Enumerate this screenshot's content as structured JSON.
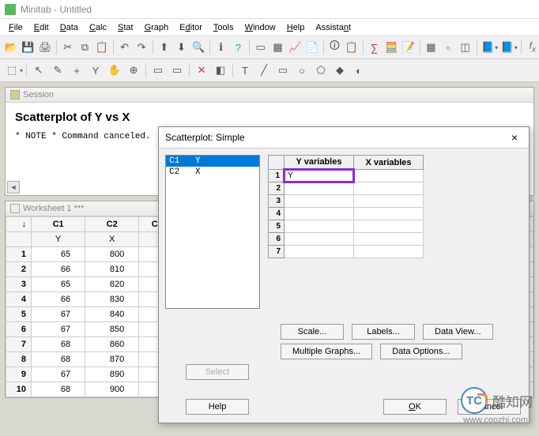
{
  "window": {
    "app": "Minitab",
    "doc": "Untitled"
  },
  "menu": [
    "File",
    "Edit",
    "Data",
    "Calc",
    "Stat",
    "Graph",
    "Editor",
    "Tools",
    "Window",
    "Help",
    "Assistant"
  ],
  "session": {
    "title": "Session",
    "heading": "Scatterplot of Y vs X",
    "note": "* NOTE * Command canceled."
  },
  "worksheet": {
    "title": "Worksheet 1 ***",
    "columns": [
      "C1",
      "C2",
      "C"
    ],
    "extracol": "10",
    "subheads": [
      "Y",
      "X",
      ""
    ],
    "rows": [
      {
        "n": 1,
        "c1": 65,
        "c2": 800
      },
      {
        "n": 2,
        "c1": 66,
        "c2": 810
      },
      {
        "n": 3,
        "c1": 65,
        "c2": 820
      },
      {
        "n": 4,
        "c1": 66,
        "c2": 830
      },
      {
        "n": 5,
        "c1": 67,
        "c2": 840
      },
      {
        "n": 6,
        "c1": 67,
        "c2": 850
      },
      {
        "n": 7,
        "c1": 68,
        "c2": 860
      },
      {
        "n": 8,
        "c1": 68,
        "c2": 870
      },
      {
        "n": 9,
        "c1": 67,
        "c2": 890
      },
      {
        "n": 10,
        "c1": 68,
        "c2": 900
      }
    ]
  },
  "dialog": {
    "title": "Scatterplot: Simple",
    "vars": [
      {
        "col": "C1",
        "name": "Y",
        "selected": true
      },
      {
        "col": "C2",
        "name": "X",
        "selected": false
      }
    ],
    "grid": {
      "yhdr": "Y variables",
      "xhdr": "X variables",
      "rows": 7,
      "yval1": "Y",
      "xval1": ""
    },
    "buttons": {
      "scale": "Scale...",
      "labels": "Labels...",
      "dataview": "Data View...",
      "multgraphs": "Multiple Graphs...",
      "dataopts": "Data Options...",
      "select": "Select",
      "help": "Help",
      "ok": "OK",
      "cancel": "Cancel"
    }
  },
  "watermark": {
    "text": "酷知网",
    "url": "www.coozhi.com",
    "logo": "TC"
  }
}
